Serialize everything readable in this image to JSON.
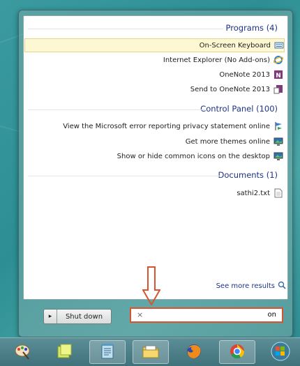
{
  "groups": [
    {
      "header": "Programs (4)",
      "items": [
        {
          "label": "On-Screen Keyboard",
          "icon": "keyboard-icon",
          "selected": true
        },
        {
          "label": "Internet Explorer (No Add-ons)",
          "icon": "internet-explorer-icon"
        },
        {
          "label": "OneNote 2013",
          "icon": "onenote-icon"
        },
        {
          "label": "Send to OneNote 2013",
          "icon": "send-to-onenote-icon"
        }
      ]
    },
    {
      "header": "Control Panel (100)",
      "items": [
        {
          "label": "View the Microsoft error reporting privacy statement online",
          "icon": "flag-icon"
        },
        {
          "label": "Get more themes online",
          "icon": "monitor-icon"
        },
        {
          "label": "Show or hide common icons on the desktop",
          "icon": "monitor-icon"
        }
      ]
    },
    {
      "header": "Documents (1)",
      "items": [
        {
          "label": "sathi2.txt",
          "icon": "text-file-icon"
        }
      ]
    }
  ],
  "see_more": "See more results",
  "shutdown": {
    "label": "Shut down",
    "arrow": "▸"
  },
  "search": {
    "value": "on",
    "clear": "×"
  },
  "annotation_color": "#d9532e",
  "taskbar": {
    "items": [
      {
        "name": "paint-icon"
      },
      {
        "name": "sticky-notes-icon"
      },
      {
        "name": "notepad-icon",
        "active": true
      },
      {
        "name": "file-explorer-icon",
        "active": true
      },
      {
        "name": "firefox-icon"
      },
      {
        "name": "chrome-icon",
        "active": true
      },
      {
        "name": "start-orb-icon"
      }
    ]
  }
}
